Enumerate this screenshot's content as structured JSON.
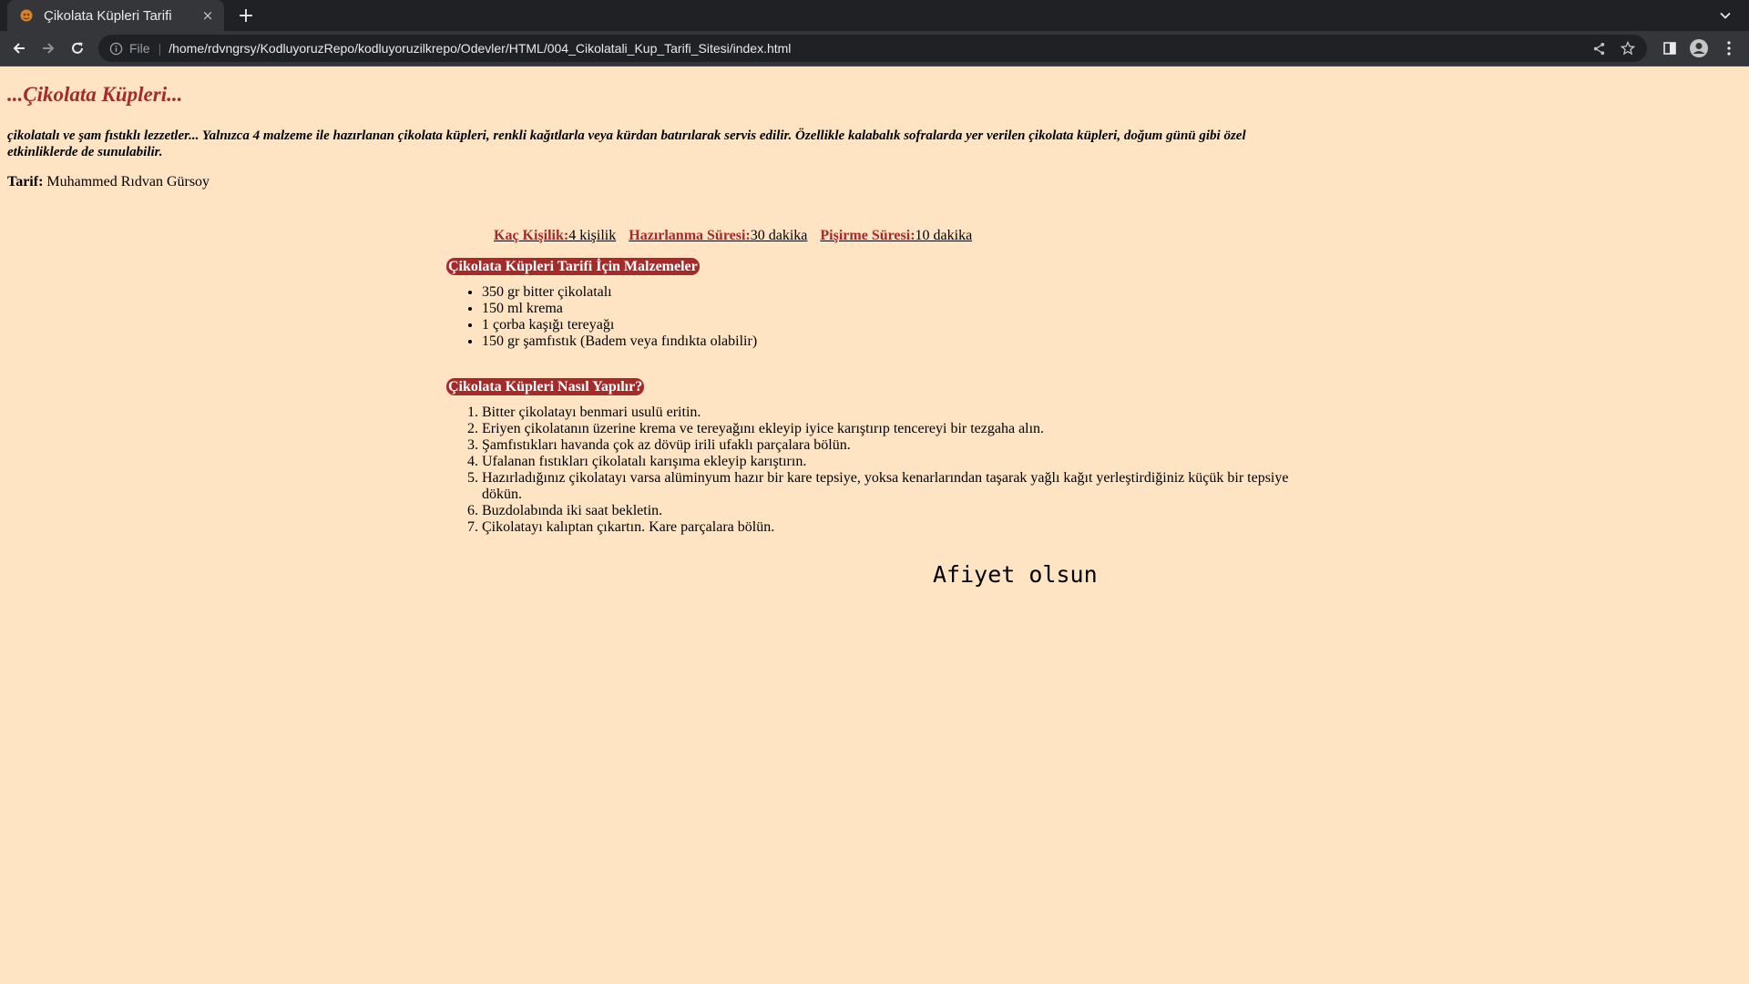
{
  "browser": {
    "tab_title": "Çikolata Küpleri Tarifi",
    "tab_close_label": "×",
    "new_tab_label": "+",
    "scheme_label": "File",
    "separator": "|",
    "url": "/home/rdvngrsy/KodluyoruzRepo/kodluyoruzilkrepo/Odevler/HTML/004_Cikolatali_Kup_Tarifi_Sitesi/index.html",
    "icons": [
      "favicon-icon",
      "close-icon",
      "plus-icon",
      "chevron-down-icon",
      "back-icon",
      "forward-icon",
      "reload-icon",
      "info-icon",
      "share-icon",
      "star-icon",
      "side-panel-icon",
      "profile-icon",
      "menu-icon"
    ],
    "colors": {
      "tabbar": "#202124",
      "toolbar": "#35363a",
      "omnibox": "#202124"
    }
  },
  "page": {
    "title": "...Çikolata Küpleri...",
    "intro": "çikolatalı ve şam fıstıklı lezzetler... Yalnızca 4 malzeme ile hazırlanan çikolata küpleri, renkli kağıtlarla veya kürdan batırılarak servis edilir. Özellikle kalabalık sofralarda yer verilen çikolata küpleri, doğum günü gibi özel etkinliklerde de sunulabilir.",
    "author_label": "Tarif:",
    "author_name": " Muhammed Rıdvan Gürsoy",
    "info": {
      "servings_label": "Kaç Kişilik:",
      "servings_value": "4 kişilik",
      "prep_label": "Hazırlanma Süresi:",
      "prep_value": "30 dakika",
      "cook_label": "Pişirme Süresi:",
      "cook_value": "10 dakika"
    },
    "ingredients_heading": "Çikolata Küpleri Tarifi İçin Malzemeler",
    "ingredients": [
      "350 gr bitter çikolatalı",
      "150 ml krema",
      "1 çorba kaşığı tereyağı",
      "150 gr şamfıstık (Badem veya fındıkta olabilir)"
    ],
    "steps_heading": "Çikolata Küpleri Nasıl Yapılır?",
    "steps": [
      "Bitter çikolatayı benmari usulü eritin.",
      "Eriyen çikolatanın üzerine krema ve tereyağını ekleyip iyice karıştırıp tencereyi bir tezgaha alın.",
      "Şamfıstıkları havanda çok az dövüp irili ufaklı parçalara bölün.",
      "Ufalanan fıstıkları çikolatalı karışıma ekleyip karıştırın.",
      "Hazırladığınız çikolatayı varsa alüminyum hazır bir kare tepsiye, yoksa kenarlarından taşarak yağlı kağıt yerleştirdiğiniz küçük bir tepsiye dökün.",
      "Buzdolabında iki saat bekletin.",
      "Çikolatayı kalıptan çıkartın. Kare parçalara bölün."
    ],
    "closing": "Afiyet olsun",
    "colors": {
      "background": "#ffe4c4",
      "accent": "#a52a2a"
    }
  }
}
